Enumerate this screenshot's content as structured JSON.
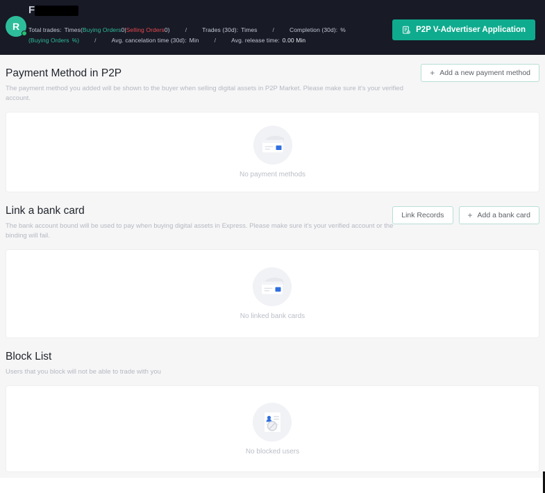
{
  "header": {
    "avatar_initial": "R",
    "avatar_color": "#2ebd9a",
    "status_dot_color": "#25c26e",
    "username_first_letter": "F",
    "username_redacted": true,
    "stats": {
      "total_trades_label": "Total trades:",
      "total_trades_value": "Times",
      "buying_orders_label": "Buying Orders",
      "buying_orders_value": "0",
      "orders_divider": "|",
      "selling_orders_label": "Selling Orders",
      "selling_orders_value": "0",
      "trades_30d_label": "Trades (30d):",
      "trades_30d_value": "Times",
      "completion_30d_label": "Completion (30d):",
      "completion_30d_value": "%",
      "completion_buying_orders_label": "(Buying Orders",
      "completion_buying_orders_value": "%)",
      "avg_cancelation_label": "Avg. cancelation time (30d):",
      "avg_cancelation_value": "Min",
      "avg_release_label": "Avg. release time:",
      "avg_release_value": "0.00 Min",
      "separator": "/"
    },
    "advertiser_button": {
      "label": "P2P V-Advertiser Application",
      "icon": "document-list-icon",
      "bg_color": "#0fab8e"
    }
  },
  "sections": [
    {
      "id": "payment-method",
      "title": "Payment Method in P2P",
      "description": "The payment method you added will be shown to the buyer when selling digital assets in P2P Market. Please make sure it's your verified account.",
      "buttons": [
        {
          "label": "Add a new payment method",
          "icon": "plus-icon",
          "name": "add-payment-method-button"
        }
      ],
      "empty_state": {
        "illustration": "credit-card-icon",
        "label": "No payment methods"
      }
    },
    {
      "id": "bank-card",
      "title": "Link a bank card",
      "description": "The bank account bound will be used to pay when buying digital assets in Express. Please make sure it's your verified account or the binding will fail.",
      "buttons": [
        {
          "label": "Link Records",
          "icon": "",
          "name": "link-records-button"
        },
        {
          "label": "Add a bank card",
          "icon": "plus-icon",
          "name": "add-bank-card-button"
        }
      ],
      "empty_state": {
        "illustration": "credit-card-icon",
        "label": "No linked bank cards"
      }
    },
    {
      "id": "block-list",
      "title": "Block List",
      "description": "Users that you block will not be able to trade with you",
      "buttons": [],
      "empty_state": {
        "illustration": "blocked-user-document-icon",
        "label": "No blocked users"
      }
    }
  ],
  "colors": {
    "header_bg": "#181a26",
    "accent_teal": "#0fab8e",
    "buy_green": "#2ebd9a",
    "sell_red": "#e8484e",
    "page_bg": "#f6f6f7",
    "panel_bg": "#ffffff"
  }
}
